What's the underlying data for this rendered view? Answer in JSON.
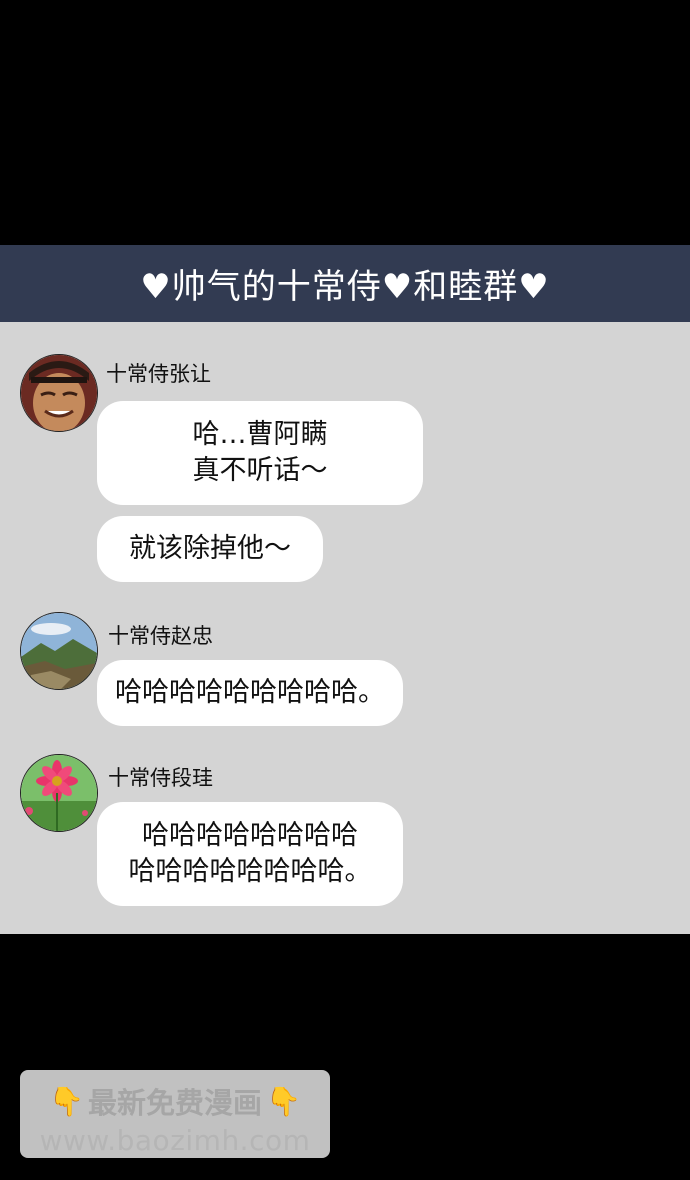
{
  "header": {
    "title": "♥帅气的十常侍♥和睦群♥"
  },
  "messages": [
    {
      "sender": "十常侍张让",
      "avatar_icon": "bald-man-avatar-icon",
      "bubbles": [
        "哈…曹阿瞒\n真不听话～",
        "就该除掉他～"
      ]
    },
    {
      "sender": "十常侍赵忠",
      "avatar_icon": "mountain-landscape-avatar-icon",
      "bubbles": [
        "哈哈哈哈哈哈哈哈哈。"
      ]
    },
    {
      "sender": "十常侍段珪",
      "avatar_icon": "pink-flower-avatar-icon",
      "bubbles": [
        "哈哈哈哈哈哈哈哈\n哈哈哈哈哈哈哈哈。"
      ]
    }
  ],
  "watermark": {
    "title": "最新免费漫画",
    "url": "www.baozimh.com",
    "icon": "pointing-down-hand-icon"
  },
  "colors": {
    "header_bg": "#323b52",
    "chat_bg": "#d4d4d4",
    "bubble_bg": "#ffffff"
  }
}
